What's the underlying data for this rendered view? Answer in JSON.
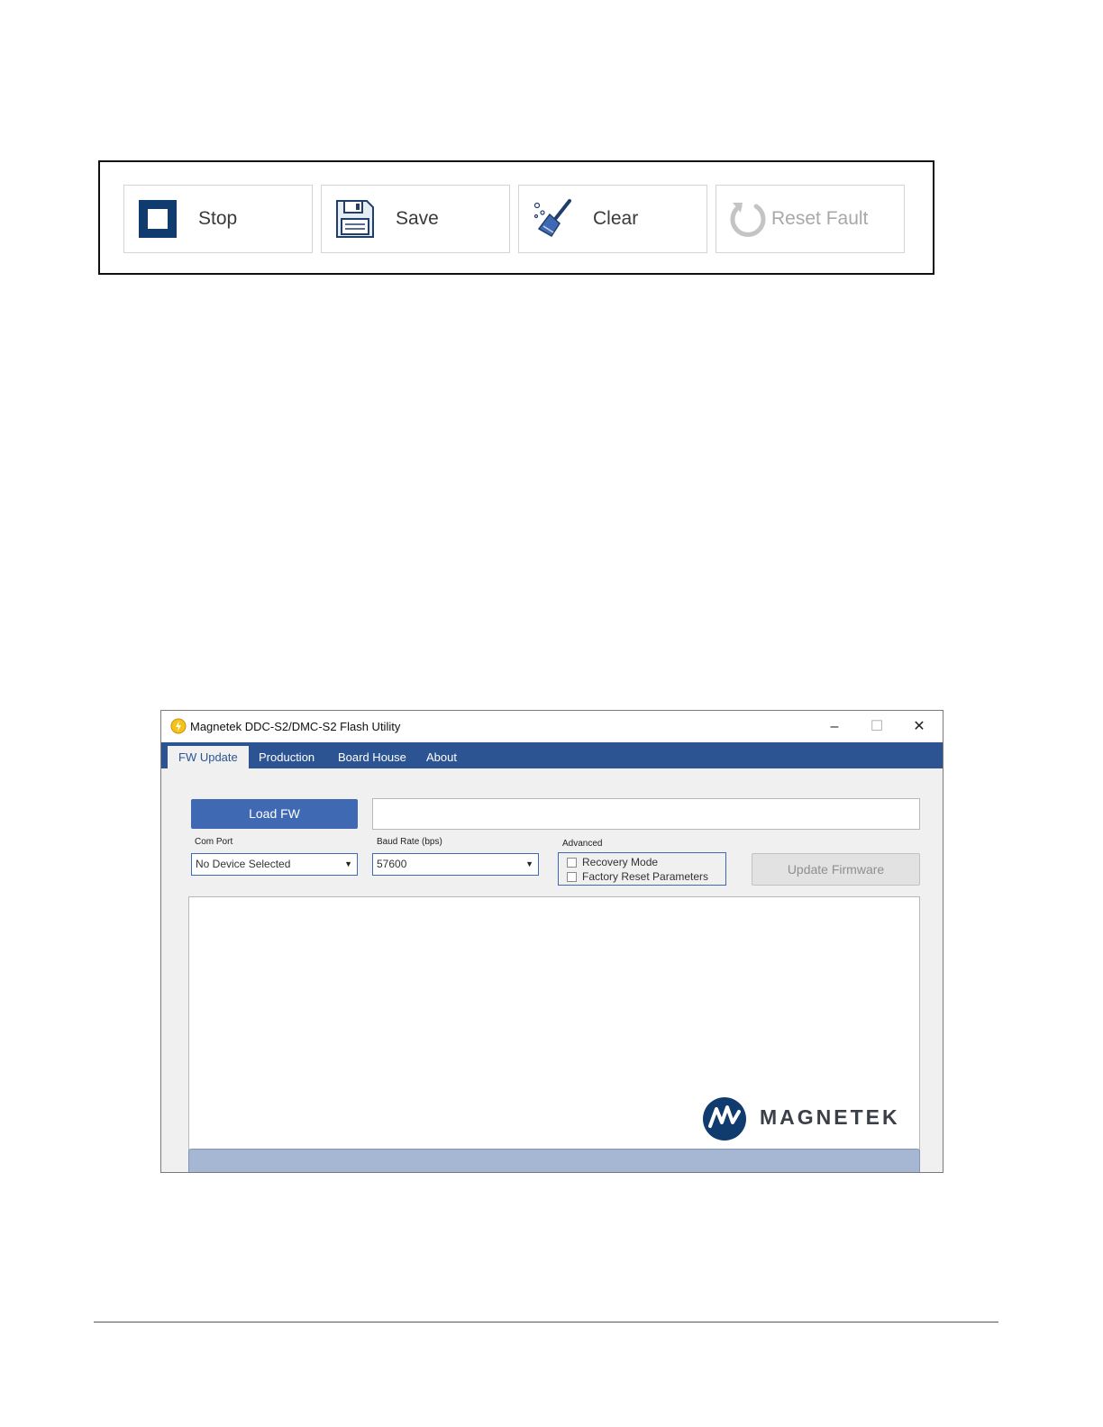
{
  "toolbar": {
    "buttons": [
      {
        "label": "Stop",
        "icon": "stop-icon",
        "enabled": true
      },
      {
        "label": "Save",
        "icon": "floppy-disk-icon",
        "enabled": true
      },
      {
        "label": "Clear",
        "icon": "broom-icon",
        "enabled": true
      },
      {
        "label": "Reset Fault",
        "icon": "refresh-icon",
        "enabled": false
      }
    ]
  },
  "window": {
    "title": "Magnetek DDC-S2/DMC-S2 Flash Utility",
    "controls": {
      "minimize": "–",
      "maximize": "☐",
      "close": "✕"
    },
    "tabs": [
      {
        "label": "FW Update",
        "active": true
      },
      {
        "label": "Production",
        "active": false
      },
      {
        "label": "Board House",
        "active": false
      },
      {
        "label": "About",
        "active": false
      }
    ],
    "load_fw_label": "Load FW",
    "file_path": "",
    "com_port": {
      "label": "Com Port",
      "value": "No Device Selected"
    },
    "baud_rate": {
      "label": "Baud Rate (bps)",
      "value": "57600"
    },
    "advanced": {
      "label": "Advanced",
      "options": [
        {
          "label": "Recovery Mode",
          "checked": false
        },
        {
          "label": "Factory Reset Parameters",
          "checked": false
        }
      ]
    },
    "update_firmware_label": "Update Firmware",
    "logo_text": "MAGNETEK",
    "colors": {
      "accent": "#2d5492",
      "button": "#3f6ab3",
      "progress": "#a6b7d3"
    }
  }
}
